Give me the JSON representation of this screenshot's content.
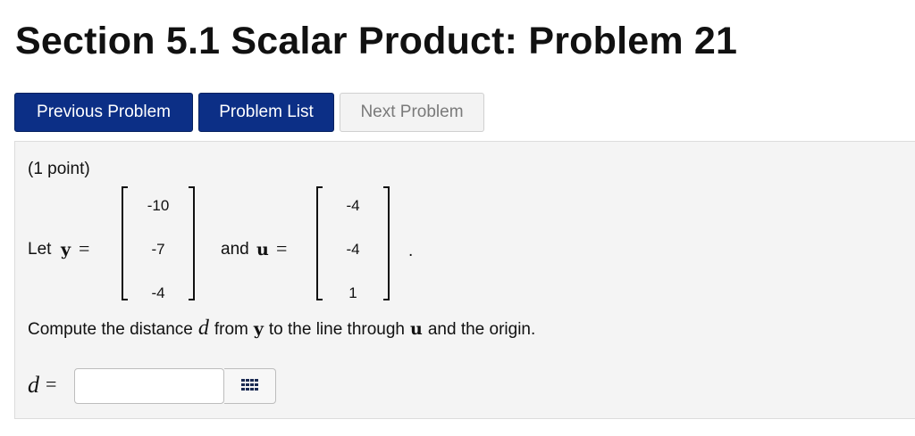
{
  "page": {
    "title": "Section 5.1 Scalar Product: Problem 21"
  },
  "nav": {
    "previous_label": "Previous Problem",
    "list_label": "Problem List",
    "next_label": "Next Problem"
  },
  "problem": {
    "points": "(1 point)",
    "let_label": "Let",
    "y_symbol": "y",
    "equals": "=",
    "and_label": "and",
    "u_symbol": "u",
    "period": ".",
    "vector_y": [
      "-10",
      "-7",
      "-4"
    ],
    "vector_u": [
      "-4",
      "-4",
      "1"
    ],
    "question": {
      "part1": "Compute the distance",
      "d_symbol": "d",
      "part2": "from",
      "y_symbol": "y",
      "part3": "to the line through",
      "u_symbol": "u",
      "part4": "and the origin."
    },
    "answer": {
      "d_symbol": "d",
      "equals": "=",
      "value": "",
      "keypad_icon": "keypad-grid-icon"
    }
  },
  "colors": {
    "primary_button": "#0c2f86",
    "disabled_button": "#f3f3f3",
    "panel_background": "#f4f4f4"
  }
}
